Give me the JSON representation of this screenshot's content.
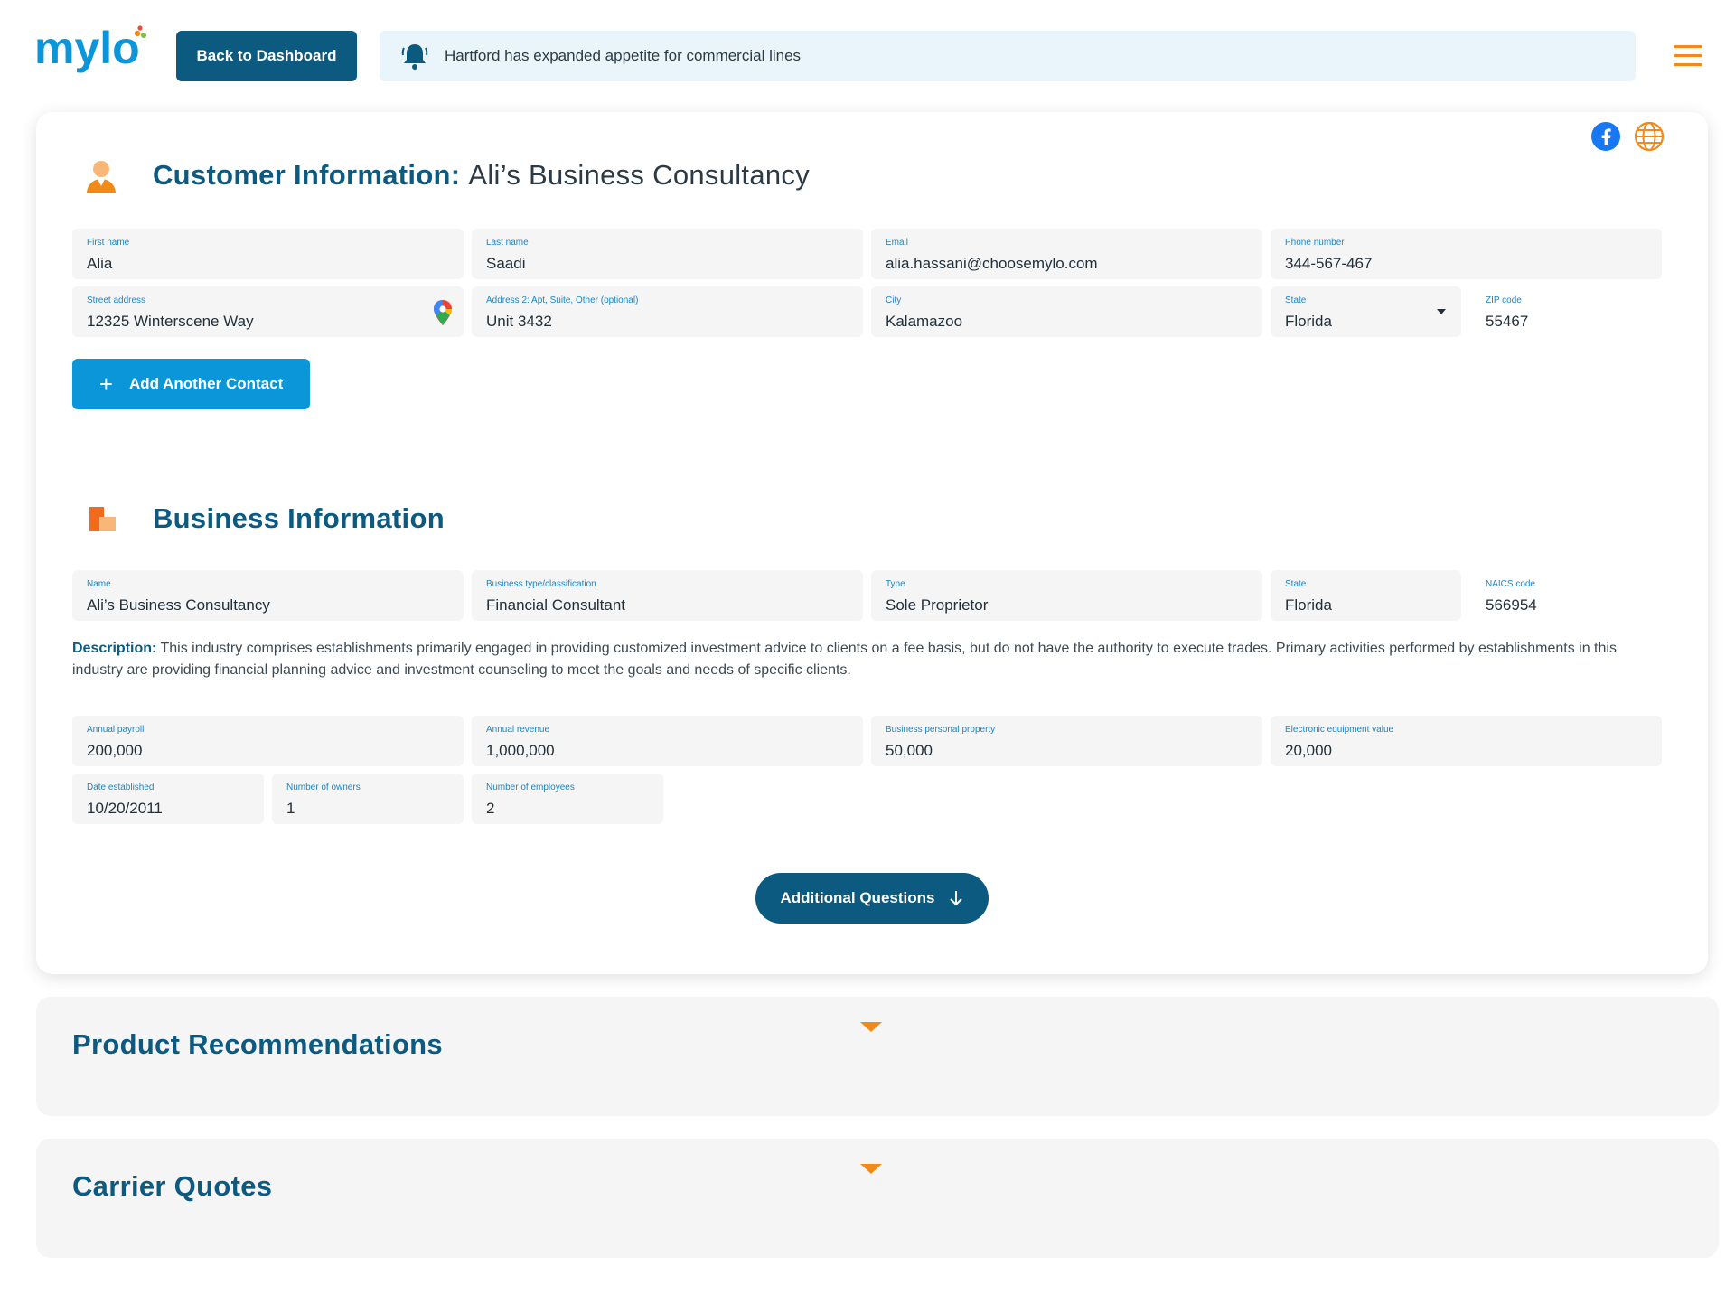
{
  "header": {
    "logo_text": "mylo",
    "back_button": "Back to Dashboard",
    "banner_text": "Hartford has expanded appetite for commercial lines"
  },
  "colors": {
    "brand_blue": "#0d5a80",
    "accent_orange": "#f28a19",
    "action_blue": "#0a96d9",
    "label_blue": "#1a86c7"
  },
  "icons": {
    "social": [
      "facebook-icon",
      "globe-icon"
    ],
    "customer_section": "person-icon",
    "business_section": "building-icon"
  },
  "customer": {
    "title_label": "Customer Information:",
    "title_name": "Ali’s Business Consultancy",
    "fields": {
      "first_name": {
        "label": "First name",
        "value": "Alia"
      },
      "last_name": {
        "label": "Last name",
        "value": "Saadi"
      },
      "email": {
        "label": "Email",
        "value": "alia.hassani@choosemylo.com"
      },
      "phone": {
        "label": "Phone number",
        "value": "344-567-467"
      },
      "street": {
        "label": "Street address",
        "value": "12325 Winterscene Way"
      },
      "address2": {
        "label": "Address 2: Apt, Suite, Other (optional)",
        "value": "Unit 3432"
      },
      "city": {
        "label": "City",
        "value": "Kalamazoo"
      },
      "state": {
        "label": "State",
        "value": "Florida"
      },
      "zip": {
        "label": "ZIP code",
        "value": "55467"
      }
    },
    "add_contact_button": "Add Another Contact"
  },
  "business": {
    "title": "Business Information",
    "fields": {
      "name": {
        "label": "Name",
        "value": "Ali’s Business Consultancy"
      },
      "type_class": {
        "label": "Business type/classification",
        "value": "Financial Consultant"
      },
      "type": {
        "label": "Type",
        "value": "Sole Proprietor"
      },
      "state": {
        "label": "State",
        "value": "Florida"
      },
      "naics": {
        "label": "NAICS code",
        "value": "566954"
      },
      "payroll": {
        "label": "Annual payroll",
        "value": "200,000"
      },
      "revenue": {
        "label": "Annual revenue",
        "value": "1,000,000"
      },
      "bpp": {
        "label": "Business personal property",
        "value": "50,000"
      },
      "electronic": {
        "label": "Electronic equipment value",
        "value": "20,000"
      },
      "established": {
        "label": "Date established",
        "value": "10/20/2011"
      },
      "owners": {
        "label": "Number of owners",
        "value": "1"
      },
      "employees": {
        "label": "Number of employees",
        "value": "2"
      }
    },
    "description_label": "Description:",
    "description_text": "This industry comprises establishments primarily engaged in providing customized investment advice to clients on a fee basis, but do not have the authority to execute trades. Primary activities performed by establishments in this industry are providing financial planning advice and investment counseling to meet the goals and needs of specific clients.",
    "additional_questions_button": "Additional Questions"
  },
  "panels": {
    "product_recommendations": "Product Recommendations",
    "carrier_quotes": "Carrier Quotes"
  }
}
